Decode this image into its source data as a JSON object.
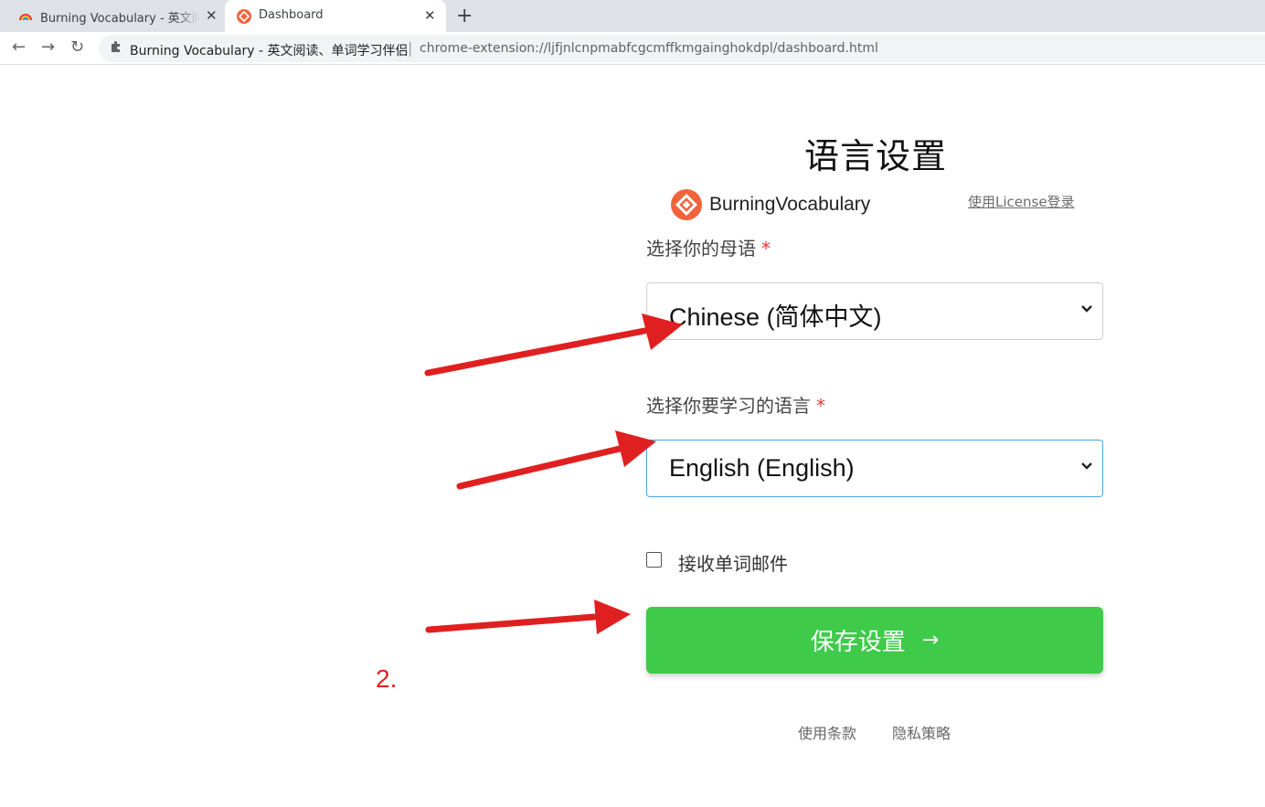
{
  "browser": {
    "tabs": [
      {
        "title": "Burning Vocabulary - 英文阅读、",
        "close": "✕"
      },
      {
        "title": "Dashboard",
        "close": "✕"
      }
    ],
    "new_tab": "+",
    "nav": {
      "back": "←",
      "forward": "→",
      "reload": "↻"
    },
    "omnibox": {
      "site_name": "Burning Vocabulary - 英文阅读、单词学习伴侣",
      "separator": "|",
      "url": "chrome-extension://ljfjnlcnpmabfcgcmffkmgainghokdpl/dashboard.html"
    }
  },
  "page": {
    "title": "语言设置",
    "brand_name": "BurningVocabulary",
    "license_link": "使用License登录",
    "native_language": {
      "label": "选择你的母语",
      "required_mark": "*",
      "selected": "Chinese (简体中文)"
    },
    "target_language": {
      "label": "选择你要学习的语言",
      "required_mark": "*",
      "selected": "English (English)"
    },
    "email_checkbox": {
      "label": "接收单词邮件",
      "checked": false
    },
    "save_button": {
      "label": "保存设置",
      "arrow": "→"
    },
    "footer": {
      "terms": "使用条款",
      "privacy": "隐私策略"
    }
  },
  "annotation": {
    "step_number": "2.",
    "color": "#e02020"
  },
  "colors": {
    "brand": "#f0643c",
    "save_green": "#3fca4a",
    "focus_blue": "#4aa3df"
  }
}
